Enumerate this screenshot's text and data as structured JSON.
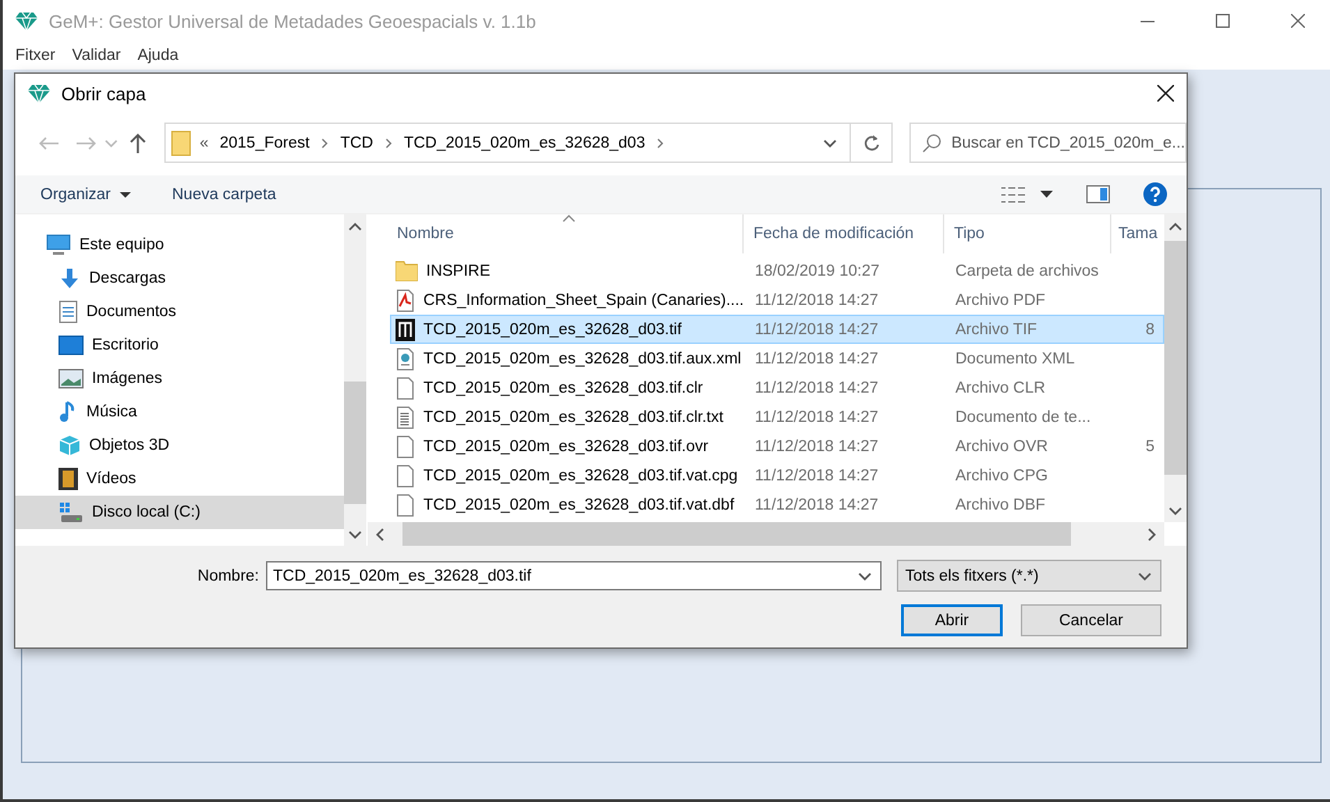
{
  "app_window": {
    "title": "GeM+: Gestor Universal de Metadades Geoespacials v. 1.1b",
    "menu": [
      "Fitxer",
      "Validar",
      "Ajuda"
    ]
  },
  "dialog": {
    "title": "Obrir capa",
    "address": {
      "overflow": "«",
      "crumbs": [
        "2015_Forest",
        "TCD",
        "TCD_2015_020m_es_32628_d03"
      ]
    },
    "search": {
      "placeholder": "Buscar en TCD_2015_020m_e..."
    },
    "toolbar": {
      "organize": "Organizar",
      "new_folder": "Nueva carpeta"
    },
    "nav": [
      {
        "label": "Este equipo",
        "kind": "computer",
        "selected": false,
        "children": [
          {
            "label": "Descargas",
            "kind": "download",
            "selected": false
          },
          {
            "label": "Documentos",
            "kind": "documents",
            "selected": false
          },
          {
            "label": "Escritorio",
            "kind": "desktop",
            "selected": false
          },
          {
            "label": "Imágenes",
            "kind": "pictures",
            "selected": false
          },
          {
            "label": "Música",
            "kind": "music",
            "selected": false
          },
          {
            "label": "Objetos 3D",
            "kind": "cube",
            "selected": false
          },
          {
            "label": "Vídeos",
            "kind": "film",
            "selected": false
          },
          {
            "label": "Disco local (C:)",
            "kind": "drive",
            "selected": true
          }
        ]
      }
    ],
    "columns": [
      "Nombre",
      "Fecha de modificación",
      "Tipo",
      "Tama"
    ],
    "files": [
      {
        "name": "INSPIRE",
        "date": "18/02/2019 10:27",
        "type": "Carpeta de archivos",
        "kind": "folder",
        "selected": false
      },
      {
        "name": "CRS_Information_Sheet_Spain (Canaries)....",
        "date": "11/12/2018 14:27",
        "type": "Archivo PDF",
        "kind": "pdf",
        "selected": false
      },
      {
        "name": "TCD_2015_020m_es_32628_d03.tif",
        "date": "11/12/2018 14:27",
        "type": "Archivo TIF",
        "size": "8",
        "kind": "tif",
        "selected": true
      },
      {
        "name": "TCD_2015_020m_es_32628_d03.tif.aux.xml",
        "date": "11/12/2018 14:27",
        "type": "Documento XML",
        "kind": "xml",
        "selected": false
      },
      {
        "name": "TCD_2015_020m_es_32628_d03.tif.clr",
        "date": "11/12/2018 14:27",
        "type": "Archivo CLR",
        "kind": "file",
        "selected": false
      },
      {
        "name": "TCD_2015_020m_es_32628_d03.tif.clr.txt",
        "date": "11/12/2018 14:27",
        "type": "Documento de te...",
        "kind": "text",
        "selected": false
      },
      {
        "name": "TCD_2015_020m_es_32628_d03.tif.ovr",
        "date": "11/12/2018 14:27",
        "type": "Archivo OVR",
        "size": "5",
        "kind": "file",
        "selected": false
      },
      {
        "name": "TCD_2015_020m_es_32628_d03.tif.vat.cpg",
        "date": "11/12/2018 14:27",
        "type": "Archivo CPG",
        "kind": "file",
        "selected": false
      },
      {
        "name": "TCD_2015_020m_es_32628_d03.tif.vat.dbf",
        "date": "11/12/2018 14:27",
        "type": "Archivo DBF",
        "kind": "file",
        "selected": false
      }
    ],
    "file_name": {
      "label": "Nombre:",
      "value": "TCD_2015_020m_es_32628_d03.tif"
    },
    "filter": "Tots els fitxers (*.*)",
    "buttons": [
      {
        "label": "Abrir",
        "default": true
      },
      {
        "label": "Cancelar",
        "default": false
      }
    ]
  }
}
